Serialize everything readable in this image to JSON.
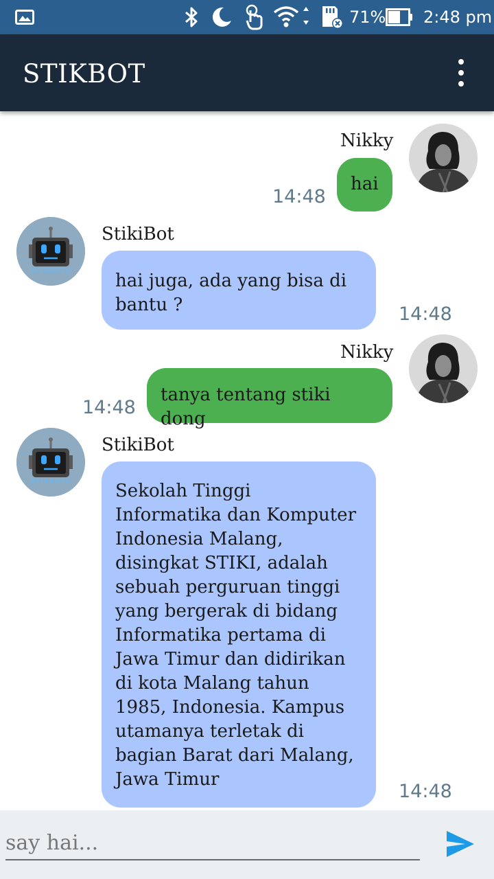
{
  "status_bar": {
    "battery": "71%",
    "time": "2:48 pm"
  },
  "app_bar": {
    "title": "STIKBOT"
  },
  "messages": [
    {
      "sender": "Nikky",
      "role": "user",
      "text": "hai",
      "time": "14:48"
    },
    {
      "sender": "StikiBot",
      "role": "bot",
      "text": "hai juga, ada yang bisa di bantu ?",
      "time": "14:48"
    },
    {
      "sender": "Nikky",
      "role": "user",
      "text": "tanya tentang stiki dong",
      "time": "14:48"
    },
    {
      "sender": "StikiBot",
      "role": "bot",
      "text": "Sekolah Tinggi Informatika dan Komputer Indonesia Malang, disingkat STIKI, adalah sebuah perguruan tinggi yang bergerak di bidang Informatika pertama di Jawa Timur dan didirikan di kota Malang tahun 1985, Indonesia. Kampus utamanya terletak di bagian Barat dari Malang, Jawa Timur",
      "time": "14:48"
    }
  ],
  "bot_avatar_label": "STIKBOTS",
  "input": {
    "placeholder": "say hai..."
  },
  "colors": {
    "status_bar": "#2b5f8f",
    "app_bar": "#1b2a3b",
    "user_bubble": "#4caf50",
    "bot_bubble": "#abc6ff",
    "send_icon": "#1e9be8"
  }
}
